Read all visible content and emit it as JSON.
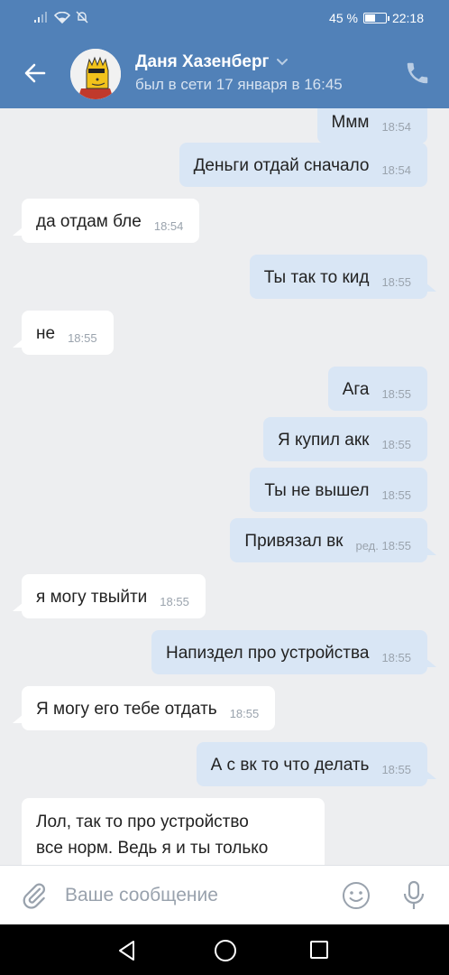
{
  "status_bar": {
    "battery_text": "45 %",
    "battery_level": 0.45,
    "time": "22:18"
  },
  "header": {
    "contact_name": "Даня Хазенберг",
    "contact_status": "был в сети 17 января в 16:45"
  },
  "messages": [
    {
      "dir": "out",
      "text": "Ммм",
      "time": "18:54"
    },
    {
      "dir": "out",
      "text": "Деньги отдай сначало",
      "time": "18:54"
    },
    {
      "dir": "in",
      "text": "да отдам бле",
      "time": "18:54"
    },
    {
      "dir": "out",
      "text": "Ты так то кид",
      "time": "18:55"
    },
    {
      "dir": "in",
      "text": "не",
      "time": "18:55"
    },
    {
      "dir": "out",
      "text": "Ага",
      "time": "18:55"
    },
    {
      "dir": "out",
      "text": "Я купил акк",
      "time": "18:55"
    },
    {
      "dir": "out",
      "text": "Ты не вышел",
      "time": "18:55"
    },
    {
      "dir": "out",
      "text": "Привязал вк",
      "time": "ред. 18:55"
    },
    {
      "dir": "in",
      "text": "я могу твыйти",
      "time": "18:55"
    },
    {
      "dir": "out",
      "text": "Напиздел про устройства",
      "time": "18:55"
    },
    {
      "dir": "in",
      "text": "Я могу его тебе отдать",
      "time": "18:55"
    },
    {
      "dir": "out",
      "text": "А с вк то что делать",
      "time": "18:55"
    },
    {
      "dir": "in",
      "line1": "Лол, так то про устройство",
      "line2": "все норм. Ведь я и ты только"
    }
  ],
  "input": {
    "placeholder": "Ваше сообщение"
  },
  "colors": {
    "header_bg": "#5181b8",
    "chat_bg": "#edeef0",
    "outgoing_bubble": "#d9e6f5",
    "incoming_bubble": "#ffffff"
  }
}
